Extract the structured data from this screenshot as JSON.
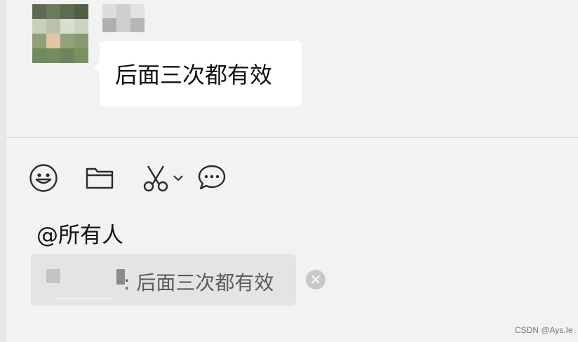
{
  "message": {
    "text": "后面三次都有效"
  },
  "toolbar": {
    "items": [
      {
        "icon": "emoji-icon"
      },
      {
        "icon": "folder-icon"
      },
      {
        "icon": "scissors-icon",
        "dropdown": true
      },
      {
        "icon": "chat-bubble-icon"
      }
    ]
  },
  "composer": {
    "mention_text": "@所有人"
  },
  "quote": {
    "text": ": 后面三次都有效"
  },
  "remove_quote": {
    "icon": "close-icon",
    "glyph": "✕"
  },
  "watermark": {
    "text": "CSDN @Ays.Ie"
  },
  "colors": {
    "background": "#f2f2f2",
    "bubble": "#ffffff",
    "quote_bg": "#e4e4e4",
    "icon": "#2b2b2b",
    "close_bg": "#c8c8c8"
  }
}
